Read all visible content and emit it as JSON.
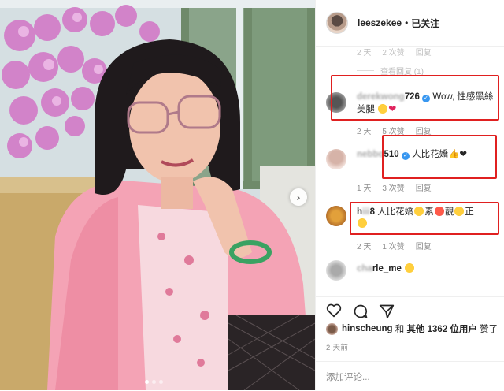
{
  "post": {
    "username": "leeszekee",
    "separator": "•",
    "follow_status": "已关注",
    "next_icon": "chevron-right-icon",
    "carousel_total": 3,
    "carousel_active": 1
  },
  "comments": {
    "faded_meta": {
      "time": "2 天",
      "likes": "2 次赞",
      "reply": "回复"
    },
    "view_replies": "查看回复 (1)",
    "items": [
      {
        "user": "derekwong726",
        "user_visible_tail": "726",
        "verified": true,
        "text": "Wow, 性感黑絲美腿",
        "text_line1": "Wow, 性感黑絲",
        "text_line2": "美腿",
        "time": "2 天",
        "likes": "5 次赞",
        "reply": "回复"
      },
      {
        "user": "nebbo510",
        "user_visible_tail": "510",
        "verified": true,
        "text": "人比花嬌👍❤",
        "time": "1 天",
        "likes": "3 次赞",
        "reply": "回复"
      },
      {
        "user": "hi8",
        "user_visible_head": "h",
        "user_visible_tail": "8",
        "text": "人比花嬌😍素😡靚😘正😍",
        "w1": "人比花嬌",
        "w2": "素",
        "w3": "靚",
        "w4": "正",
        "time": "2 天",
        "likes": "1 次赞",
        "reply": "回复"
      },
      {
        "user": "rle_me",
        "user_visible_tail": "rle_me",
        "text": "😍"
      }
    ]
  },
  "actions": {
    "like_icon": "heart-outline-icon",
    "comment_icon": "comment-bubble-icon",
    "share_icon": "paper-plane-icon"
  },
  "likes": {
    "user": "hinscheung",
    "connector": "和",
    "others": "其他 1362 位用户",
    "suffix": "赞了"
  },
  "posted": "2 天前",
  "add_comment_placeholder": "添加评论...",
  "colors": {
    "highlight_box": "#e02020",
    "verified": "#3897f0",
    "heart": "#e0245e"
  }
}
